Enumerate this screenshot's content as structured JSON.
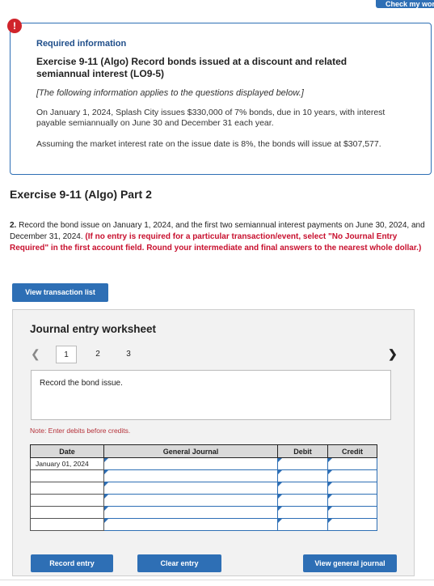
{
  "top_button": {
    "label": "Check my work"
  },
  "info": {
    "heading": "Required information",
    "title": "Exercise 9-11 (Algo) Record bonds issued at a discount and related semiannual interest (LO9-5)",
    "note": "[The following information applies to the questions displayed below.]",
    "paragraph1": "On January 1, 2024, Splash City issues $330,000 of 7% bonds, due in 10 years, with interest payable semiannually on June 30 and December 31 each year.",
    "paragraph2": "Assuming the market interest rate on the issue date is 8%, the bonds will issue at $307,577."
  },
  "part_heading": "Exercise 9-11 (Algo) Part 2",
  "instructions": {
    "number": "2.",
    "text": " Record the bond issue on January 1, 2024, and the first two semiannual interest payments on June 30, 2024, and December 31, 2024. ",
    "emphasis": "(If no entry is required for a particular transaction/event, select \"No Journal Entry Required\" in the first account field. Round your intermediate and final answers to the nearest whole dollar.)"
  },
  "view_transaction_list": "View transaction list",
  "worksheet": {
    "title": "Journal entry worksheet",
    "pages": [
      "1",
      "2",
      "3"
    ],
    "active_page": "1",
    "prompt": "Record the bond issue.",
    "note": "Note: Enter debits before credits.",
    "columns": {
      "date": "Date",
      "general_journal": "General Journal",
      "debit": "Debit",
      "credit": "Credit"
    },
    "rows": [
      {
        "date": "January 01, 2024"
      },
      {
        "date": ""
      },
      {
        "date": ""
      },
      {
        "date": ""
      },
      {
        "date": ""
      },
      {
        "date": ""
      }
    ],
    "buttons": {
      "record": "Record entry",
      "clear": "Clear entry",
      "view_journal": "View general journal"
    }
  },
  "colors": {
    "accent": "#2e6fb5",
    "alert": "#d0242b",
    "warning_text": "#c8102e"
  },
  "icons": {
    "alert": "exclamation-icon",
    "prev": "chevron-left-icon",
    "next": "chevron-right-icon"
  }
}
